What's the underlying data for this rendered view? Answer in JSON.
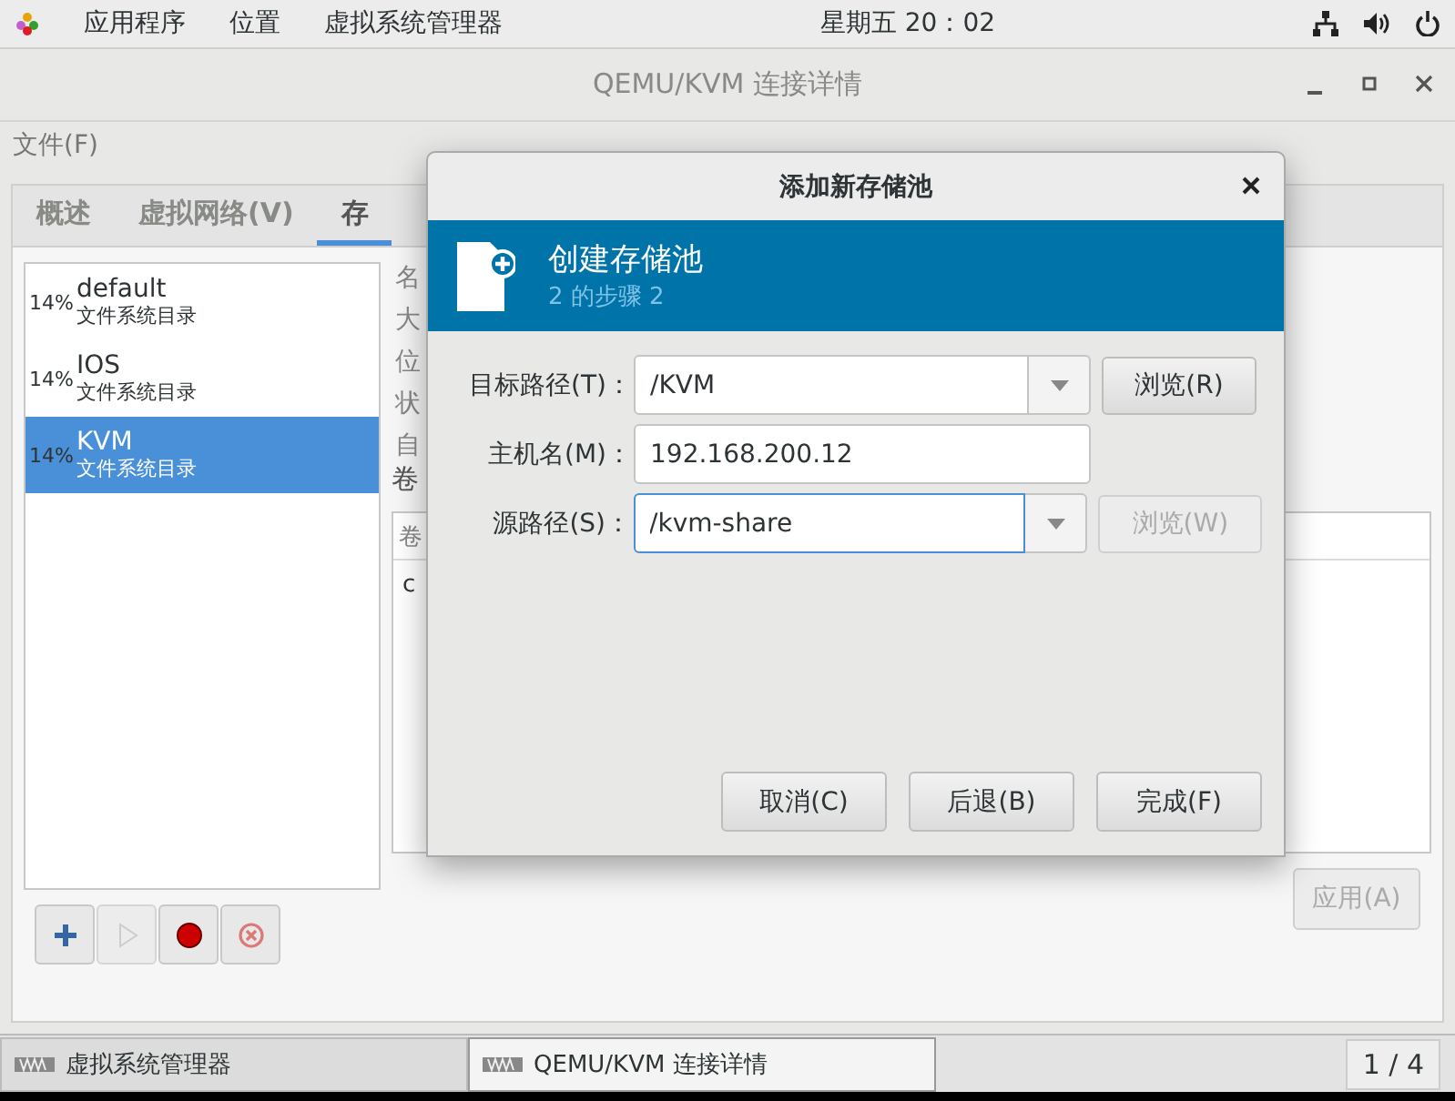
{
  "top_bar": {
    "menus": [
      "应用程序",
      "位置",
      "虚拟系统管理器"
    ],
    "clock": "星期五 20：02"
  },
  "window": {
    "title": "QEMU/KVM 连接详情",
    "menu": [
      "文件(F)"
    ],
    "tabs": [
      {
        "label": "概述",
        "selected": false
      },
      {
        "label": "虚拟网络(V)",
        "selected": false
      },
      {
        "label": "存",
        "selected": true
      }
    ],
    "pools": [
      {
        "usage": "14%",
        "name": "default",
        "type": "文件系统目录",
        "selected": false
      },
      {
        "usage": "14%",
        "name": "IOS",
        "type": "文件系统目录",
        "selected": false
      },
      {
        "usage": "14%",
        "name": "KVM",
        "type": "文件系统目录",
        "selected": true
      }
    ],
    "detail_labels": [
      "名",
      "大",
      "位",
      "状",
      "自"
    ],
    "volumes_label": "卷",
    "volumes": {
      "header": "卷",
      "rows": [
        "c"
      ]
    },
    "tools": [
      {
        "kind": "add",
        "disabled": false
      },
      {
        "kind": "start",
        "disabled": true
      },
      {
        "kind": "stop",
        "disabled": false
      },
      {
        "kind": "delete",
        "disabled": false
      }
    ],
    "apply": {
      "label": "应用(A)",
      "disabled": true
    }
  },
  "dialog": {
    "title": "添加新存储池",
    "header": {
      "title": "创建存储池",
      "step": "2 的步骤 2"
    },
    "fields": [
      {
        "kind": "combo",
        "label": "目标路径(T)：",
        "value": "/KVM",
        "focused": false,
        "browse": {
          "label": "浏览(R)",
          "disabled": false
        }
      },
      {
        "kind": "text",
        "label": "主机名(M)：",
        "value": "192.168.200.12",
        "focused": false
      },
      {
        "kind": "combo",
        "label": "源路径(S)：",
        "value": "/kvm-share",
        "focused": true,
        "browse": {
          "label": "浏览(W)",
          "disabled": true
        }
      }
    ],
    "buttons": [
      "取消(C)",
      "后退(B)",
      "完成(F)"
    ]
  },
  "taskbar": {
    "tasks": [
      {
        "label": "虚拟系统管理器",
        "selected": false
      },
      {
        "label": "QEMU/KVM 连接详情",
        "selected": true
      }
    ],
    "pager": "1 / 4"
  }
}
